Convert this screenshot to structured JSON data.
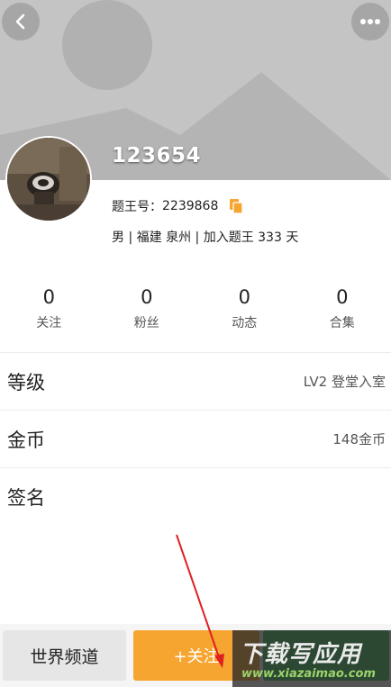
{
  "profile": {
    "username": "123654",
    "id_label": "题王号：",
    "id_value": "2239868",
    "gender": "男",
    "location": "福建 泉州",
    "joined": "加入题王 333 天",
    "separator": "|"
  },
  "stats": [
    {
      "value": "0",
      "label": "关注"
    },
    {
      "value": "0",
      "label": "粉丝"
    },
    {
      "value": "0",
      "label": "动态"
    },
    {
      "value": "0",
      "label": "合集"
    }
  ],
  "details": {
    "level_title": "等级",
    "level_value": "LV2 登堂入室",
    "coins_title": "金币",
    "coins_value": "148金币",
    "signature_title": "签名"
  },
  "bottom_bar": {
    "world_label": "世界频道",
    "follow_label": "+关注"
  },
  "watermark": {
    "main": "下载写应用",
    "url": "www.xiazaimao.com"
  },
  "colors": {
    "accent_orange": "#f6a531",
    "accent_green": "#3cb956",
    "copy_icon": "#f6a531",
    "annotation_arrow": "#e02020"
  },
  "icons": {
    "back": "back-icon",
    "more": "more-icon",
    "copy": "copy-icon"
  }
}
